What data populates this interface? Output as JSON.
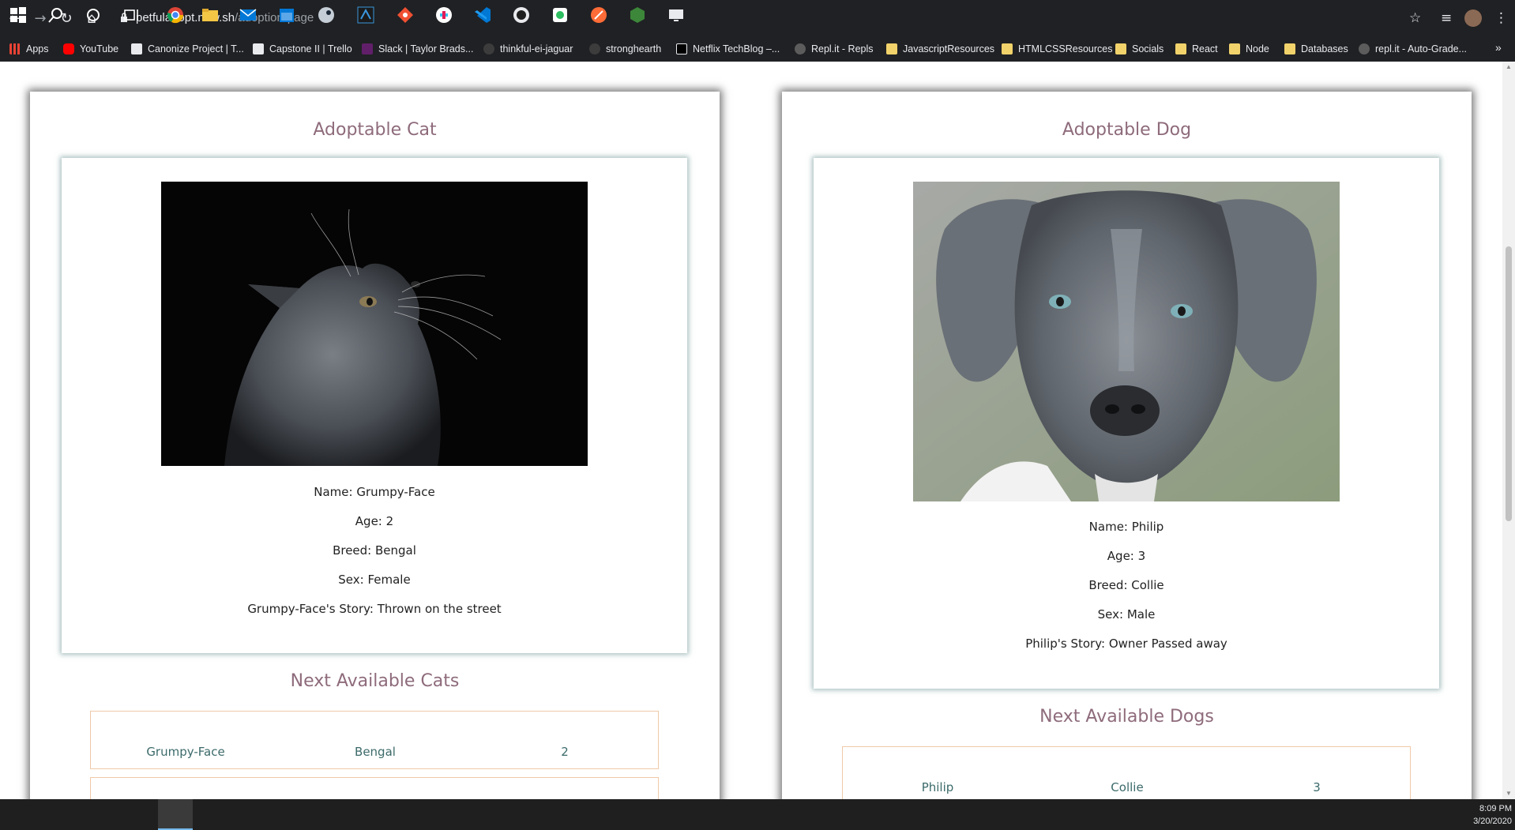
{
  "browser": {
    "url_host": "petfuladopt.now.sh",
    "url_path": "/adoption-page",
    "bookmarks": [
      {
        "label": "Apps",
        "icon": "apps-grid-icon"
      },
      {
        "label": "YouTube",
        "icon": "youtube-icon"
      },
      {
        "label": "Canonize Project | T...",
        "icon": "trello-icon"
      },
      {
        "label": "Capstone II | Trello",
        "icon": "trello-icon"
      },
      {
        "label": "Slack | Taylor Brads...",
        "icon": "slack-icon"
      },
      {
        "label": "thinkful-ei-jaguar",
        "icon": "github-icon"
      },
      {
        "label": "stronghearth",
        "icon": "github-icon"
      },
      {
        "label": "Netflix TechBlog –...",
        "icon": "medium-icon"
      },
      {
        "label": "Repl.it - Repls",
        "icon": "replit-icon"
      },
      {
        "label": "JavascriptResources",
        "icon": "folder-icon"
      },
      {
        "label": "HTMLCSSResources",
        "icon": "folder-icon"
      },
      {
        "label": "Socials",
        "icon": "folder-icon"
      },
      {
        "label": "React",
        "icon": "folder-icon"
      },
      {
        "label": "Node",
        "icon": "folder-icon"
      },
      {
        "label": "Databases",
        "icon": "folder-icon"
      },
      {
        "label": "repl.it - Auto-Grade...",
        "icon": "replit-icon"
      }
    ]
  },
  "cat": {
    "title": "Adoptable Cat",
    "name": "Name: Grumpy-Face",
    "age": "Age: 2",
    "breed": "Breed: Bengal",
    "sex": "Sex: Female",
    "story": "Grumpy-Face's Story: Thrown on the street",
    "next_title": "Next Available Cats",
    "next": [
      {
        "name": "Grumpy-Face",
        "breed": "Bengal",
        "age": "2"
      }
    ]
  },
  "dog": {
    "title": "Adoptable Dog",
    "name": "Name: Philip",
    "age": "Age: 3",
    "breed": "Breed: Collie",
    "sex": "Sex: Male",
    "story": "Philip's Story: Owner Passed away",
    "next_title": "Next Available Dogs",
    "next": [
      {
        "name": "Philip",
        "breed": "Collie",
        "age": "3"
      }
    ]
  },
  "taskbar": {
    "time": "8:09 PM",
    "date": "3/20/2020"
  },
  "colors": {
    "heading": "#8e6b7b",
    "table_border": "#f0c9a8",
    "table_text": "#3c6a6a"
  }
}
